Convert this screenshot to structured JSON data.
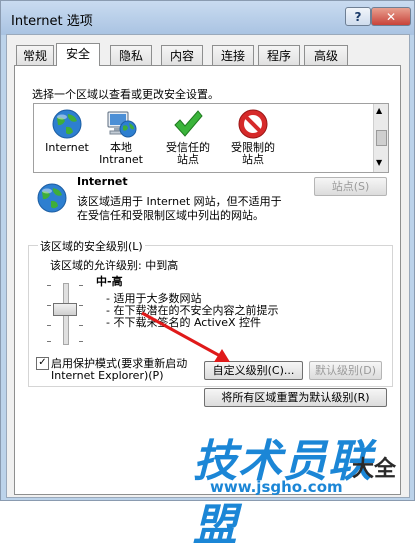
{
  "window": {
    "title": "Internet 选项",
    "help_label": "?",
    "close_label": "✕"
  },
  "tabs": [
    "常规",
    "安全",
    "隐私",
    "内容",
    "连接",
    "程序",
    "高级"
  ],
  "instruction": "选择一个区域以查看或更改安全设置。",
  "zones": [
    {
      "label_line1": "Internet",
      "label_line2": "",
      "icon": "globe-icon"
    },
    {
      "label_line1": "本地",
      "label_line2": "Intranet",
      "icon": "computer-globe-icon"
    },
    {
      "label_line1": "受信任的",
      "label_line2": "站点",
      "icon": "checkmark-icon"
    },
    {
      "label_line1": "受限制的",
      "label_line2": "站点",
      "icon": "no-entry-icon"
    }
  ],
  "selected_zone": {
    "name": "Internet",
    "desc_line1": "该区域适用于 Internet 网站，但不适用于",
    "desc_line2": "在受信任和受限制区域中列出的网站。",
    "sites_button": "站点(S)"
  },
  "security_level": {
    "group_title": "该区域的安全级别(L)",
    "allowed_label": "该区域的允许级别: 中到高",
    "level_name": "中-高",
    "bullets": [
      "- 适用于大多数网站",
      "- 在下载潜在的不安全内容之前提示",
      "- 不下载未签名的 ActiveX 控件"
    ]
  },
  "protected_mode": {
    "checked": true,
    "label_line1": "启用保护模式(要求重新启动",
    "label_line2": "Internet Explorer)(P)"
  },
  "buttons": {
    "custom_level": "自定义级别(C)...",
    "default_level": "默认级别(D)",
    "reset_all": "将所有区域重置为默认级别(R)"
  },
  "watermark": {
    "text": "技术员联盟",
    "url": "www.jsgho.com",
    "brand": "大全"
  }
}
